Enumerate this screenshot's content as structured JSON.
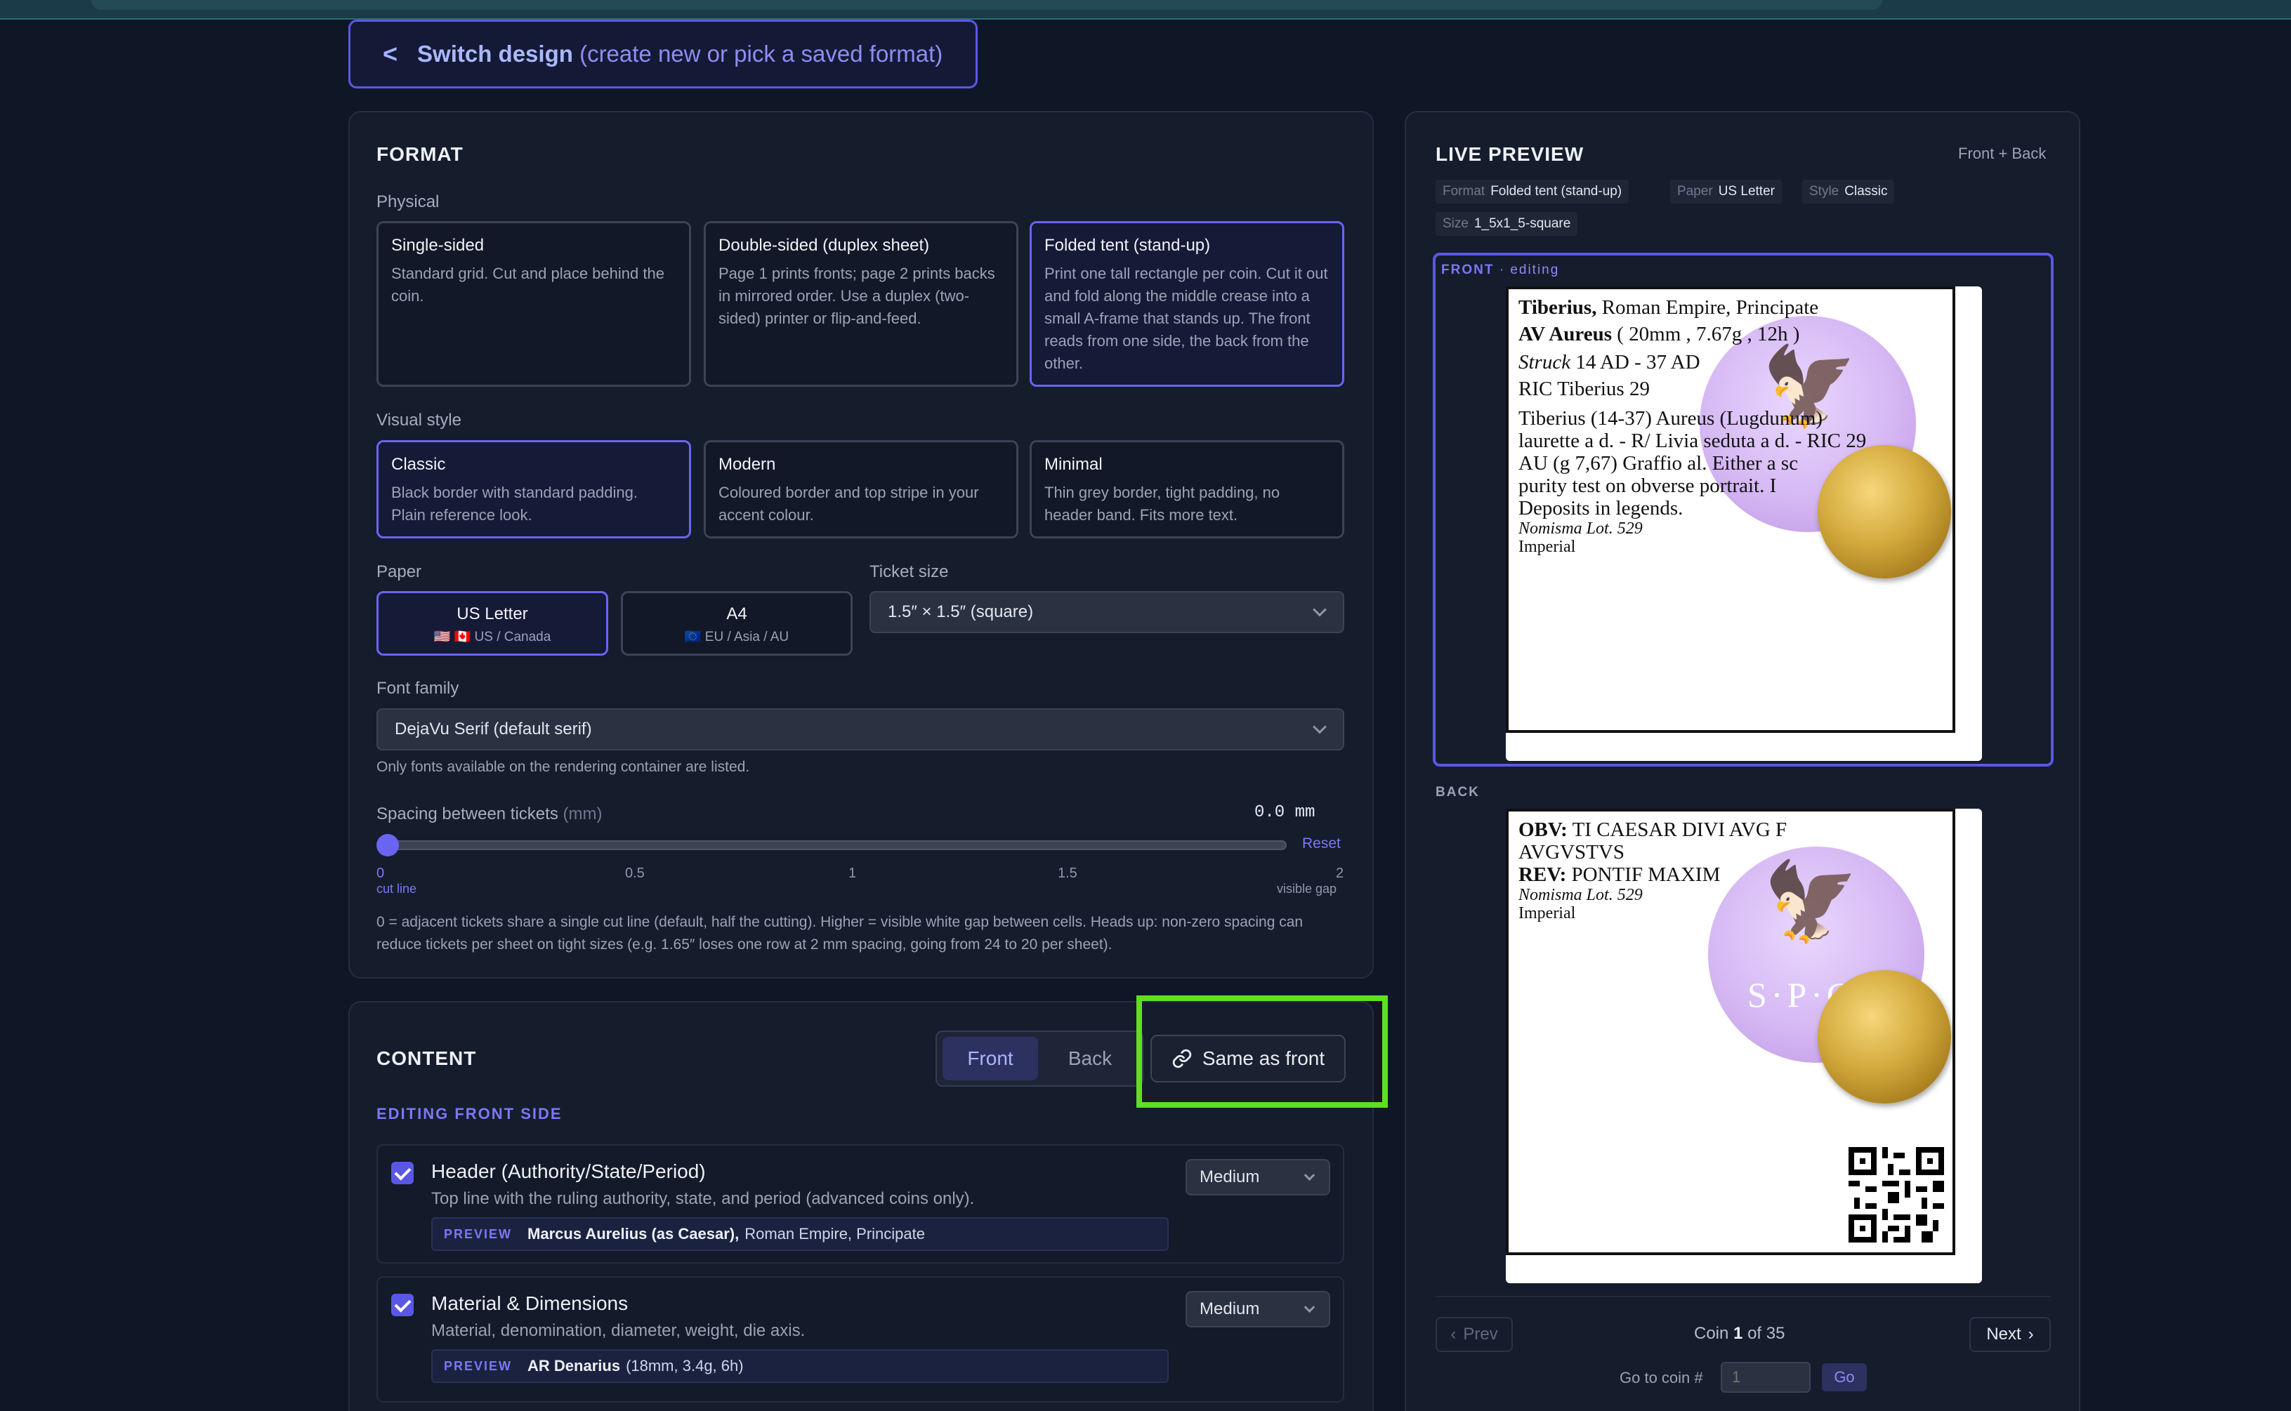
{
  "switch_design": {
    "title": "Switch design",
    "subtitle": "(create new or pick a saved format)"
  },
  "format": {
    "title": "FORMAT",
    "physical_label": "Physical",
    "physical_options": [
      {
        "title": "Single-sided",
        "desc": "Standard grid. Cut and place behind the coin."
      },
      {
        "title": "Double-sided (duplex sheet)",
        "desc": "Page 1 prints fronts; page 2 prints backs in mirrored order. Use a duplex (two-sided) printer or flip-and-feed."
      },
      {
        "title": "Folded tent (stand-up)",
        "desc": "Print one tall rectangle per coin. Cut it out and fold along the middle crease into a small A-frame that stands up. The front reads from one side, the back from the other."
      }
    ],
    "visual_label": "Visual style",
    "visual_options": [
      {
        "title": "Classic",
        "desc": "Black border with standard padding. Plain reference look."
      },
      {
        "title": "Modern",
        "desc": "Coloured border and top stripe in your accent colour."
      },
      {
        "title": "Minimal",
        "desc": "Thin grey border, tight padding, no header band. Fits more text."
      }
    ],
    "paper_label": "Paper",
    "paper_options": [
      {
        "title": "US Letter",
        "sub": "🇺🇸 🇨🇦 US / Canada"
      },
      {
        "title": "A4",
        "sub": "🇪🇺 EU / Asia / AU"
      }
    ],
    "ticket_label": "Ticket size",
    "ticket_value": "1.5″ × 1.5″ (square)",
    "font_label": "Font family",
    "font_value": "DejaVu Serif (default serif)",
    "font_note": "Only fonts available on the rendering container are listed.",
    "spacing_label": "Spacing between tickets",
    "spacing_unit": "(mm)",
    "spacing_value": "0.0 mm",
    "spacing_level": 0,
    "reset": "Reset",
    "ticks": [
      "0",
      "0.5",
      "1",
      "1.5",
      "2"
    ],
    "tick_left_note": "cut line",
    "tick_right_note": "visible gap",
    "spacing_note": "0 = adjacent tickets share a single cut line (default, half the cutting). Higher = visible white gap between cells. Heads up: non-zero spacing can reduce tickets per sheet on tight sizes (e.g. 1.65″ loses one row at 2 mm spacing, going from 24 to 20 per sheet)."
  },
  "content": {
    "title": "CONTENT",
    "seg_front": "Front",
    "seg_back": "Back",
    "same_as_front": "Same as front",
    "editing_label": "EDITING FRONT SIDE",
    "preview_tag": "PREVIEW",
    "rows": [
      {
        "title": "Header (Authority/State/Period)",
        "desc": "Top line with the ruling authority, state, and period (advanced coins only).",
        "size": "Medium",
        "preview_bold": "Marcus Aurelius (as Caesar),",
        "preview_rest": "Roman Empire, Principate"
      },
      {
        "title": "Material & Dimensions",
        "desc": "Material, denomination, diameter, weight, die axis.",
        "size": "Medium",
        "preview_bold": "AR Denarius",
        "preview_rest": "(18mm, 3.4g, 6h)"
      }
    ]
  },
  "preview": {
    "title": "LIVE PREVIEW",
    "mode": "Front + Back",
    "chips": [
      {
        "k": "Format",
        "v": "Folded tent (stand-up)"
      },
      {
        "k": "Paper",
        "v": "US Letter"
      },
      {
        "k": "Style",
        "v": "Classic"
      },
      {
        "k": "Size",
        "v": "1_5x1_5-square"
      }
    ],
    "front_label": "FRONT",
    "front_state": "· editing",
    "back_label": "BACK",
    "front_lines": {
      "l1_bold": "Tiberius,",
      "l1_rest": "Roman Empire, Principate",
      "l2_bold": "AV Aureus",
      "l2_rest": "( 20mm , 7.67g , 12h )",
      "l3_ital": "Struck",
      "l3_rest": "14 AD - 37 AD",
      "l4": "RIC Tiberius 29",
      "l5": "Tiberius (14-37) Aureus (Lugdunum)",
      "l6": "laurette a d. - R/ Livia seduta a d. - RIC 29",
      "l7": "AU (g 7,67) Graffio al. Either a sc",
      "l8": "purity test on obverse portrait. I",
      "l9": "Deposits in legends.",
      "l10": "Nomisma Lot. 529",
      "l11": "Imperial"
    },
    "back_lines": {
      "obv_k": "OBV:",
      "obv_v": "TI CAESAR DIVI AVG F",
      "obv_v2": "AVGVSTVS",
      "rev_k": "REV:",
      "rev_v": "PONTIF MAXIM",
      "lot": "Nomisma Lot. 529",
      "period": "Imperial",
      "medal_text": "S·P·C"
    },
    "prev": "Prev",
    "next": "Next",
    "coin_prefix": "Coin",
    "coin_num": "1",
    "coin_suffix": "of 35",
    "goto_label": "Go to coin #",
    "goto_placeholder": "1",
    "go": "Go"
  }
}
